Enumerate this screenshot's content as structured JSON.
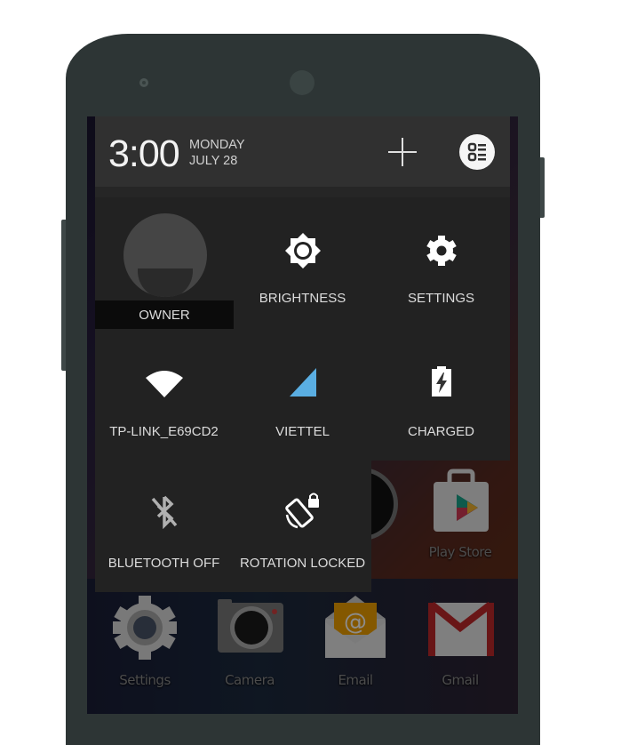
{
  "header": {
    "time": "3:00",
    "day": "MONDAY",
    "date": "JULY 28",
    "add_icon": "plus-icon",
    "settings_icon": "quick-settings-list-icon"
  },
  "quick_settings": {
    "tiles": [
      {
        "label": "OWNER",
        "icon": "user-avatar-icon"
      },
      {
        "label": "BRIGHTNESS",
        "icon": "brightness-icon"
      },
      {
        "label": "SETTINGS",
        "icon": "gear-icon"
      },
      {
        "label": "TP-LINK_E69CD2",
        "icon": "wifi-icon"
      },
      {
        "label": "VIETTEL",
        "icon": "cellular-signal-icon"
      },
      {
        "label": "CHARGED",
        "icon": "battery-charging-icon"
      },
      {
        "label": "BLUETOOTH OFF",
        "icon": "bluetooth-off-icon"
      },
      {
        "label": "ROTATION LOCKED",
        "icon": "rotation-lock-icon"
      }
    ],
    "signal_color": "#5aaee2"
  },
  "home_screen": {
    "apps": [
      {
        "label": "Play Store",
        "icon": "play-store-icon"
      },
      {
        "label": "Settings",
        "icon": "settings-app-icon"
      },
      {
        "label": "Camera",
        "icon": "camera-icon"
      },
      {
        "label": "Email",
        "icon": "email-icon"
      },
      {
        "label": "Gmail",
        "icon": "gmail-icon"
      }
    ]
  }
}
